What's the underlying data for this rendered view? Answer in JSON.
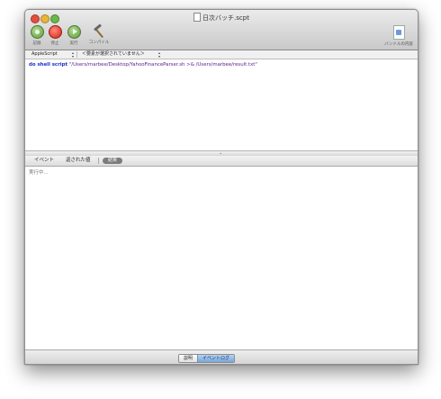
{
  "window": {
    "title": "日次バッチ.scpt"
  },
  "toolbar": {
    "record_label": "記録",
    "stop_label": "停止",
    "run_label": "実行",
    "compile_label": "コンパイル",
    "bundle_label": "バンドルの内容"
  },
  "navbar": {
    "language": "AppleScript",
    "element": "＜要素が選択されていません＞"
  },
  "editor": {
    "keyword": "do shell script",
    "argument": " \"/Users/marbee/Desktop/YahooFinanceParser.sh >& /Users/marbee/result.txt\""
  },
  "tabs": {
    "events": "イベント",
    "returned_values": "返された値",
    "result": "結果"
  },
  "result": {
    "status": "実行中..."
  },
  "bottom": {
    "description": "説明",
    "event_log": "イベントログ"
  },
  "colors": {
    "keyword": "#1b2fc8",
    "string": "#5a1c8a",
    "active_segment": "#77a6dc"
  }
}
